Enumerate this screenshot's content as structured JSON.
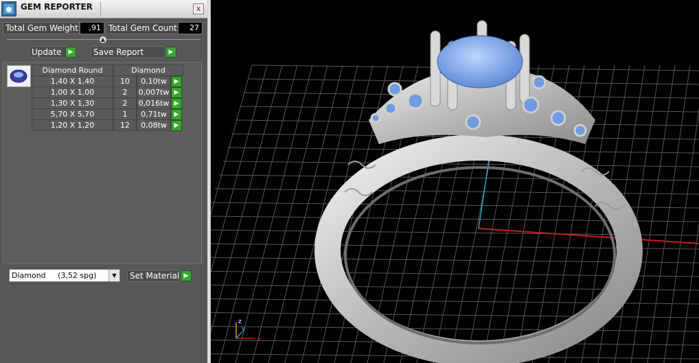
{
  "panel": {
    "title": "GEM REPORTER",
    "close_label": "x",
    "total_gem_weight_label": "Total Gem Weight",
    "total_gem_weight_value": ",91",
    "total_gem_count_label": "Total Gem Count",
    "total_gem_count_value": "27",
    "update_label": "Update",
    "save_report_label": "Save Report",
    "table": {
      "header_shape": "Diamond Round",
      "header_material": "Diamond",
      "rows": [
        {
          "size": "1,40 X 1,40",
          "count": "10",
          "weight": "0,10tw"
        },
        {
          "size": "1,00 X 1,00",
          "count": "2",
          "weight": "0,007tw"
        },
        {
          "size": "1,30 X 1,30",
          "count": "2",
          "weight": "0,016tw"
        },
        {
          "size": "5,70 X 5,70",
          "count": "1",
          "weight": "0,71tw"
        },
        {
          "size": "1,20 X 1,20",
          "count": "12",
          "weight": "0,08tw"
        }
      ]
    },
    "material_select_value": "Diamond     (3,52 spg)",
    "set_material_label": "Set Material"
  },
  "viewport": {
    "axis_labels": {
      "z": "z",
      "y": "y",
      "x": "x"
    },
    "colors": {
      "background": "#000000",
      "grid": "#5a5a5a",
      "axis_red": "#c81e1e",
      "axis_cyan": "#2aa8c8",
      "metal": "#c8c8c8",
      "gem": "#7aa6e0"
    }
  },
  "icons": {
    "app": "gem-reporter-icon",
    "close": "close-icon",
    "go": "green-play-icon",
    "dropdown": "chevron-down-icon",
    "thumb": "round-diamond-icon"
  }
}
